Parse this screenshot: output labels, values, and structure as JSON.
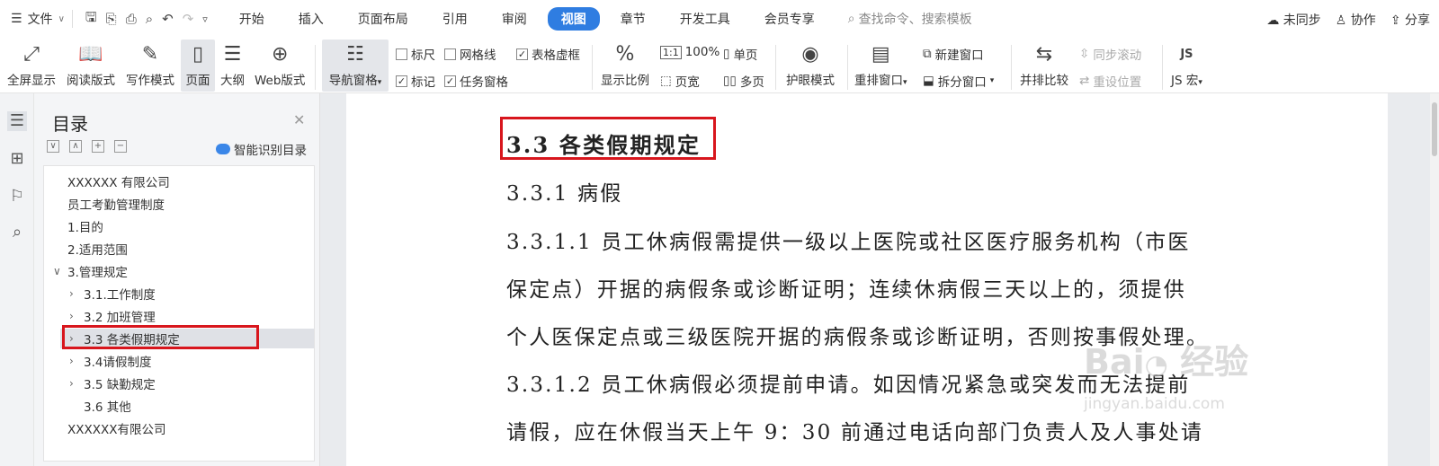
{
  "menubar": {
    "file_label": "文件",
    "tabs": [
      "开始",
      "插入",
      "页面布局",
      "引用",
      "审阅",
      "视图",
      "章节",
      "开发工具",
      "会员专享"
    ],
    "active_tab": "视图",
    "search_placeholder": "查找命令、搜索模板",
    "sync": "未同步",
    "collab": "协作",
    "share": "分享"
  },
  "ribbon": {
    "fullscreen": "全屏显示",
    "reading": "阅读版式",
    "writing": "写作模式",
    "page": "页面",
    "outline": "大纲",
    "web": "Web版式",
    "nav_pane": "导航窗格",
    "ruler": "标尺",
    "gridlines": "网格线",
    "table_border": "表格虚框",
    "mark": "标记",
    "task_pane": "任务窗格",
    "zoom": "显示比例",
    "zoom_100": "100%",
    "page_width": "页宽",
    "single_page": "单页",
    "multi_page": "多页",
    "eye_mode": "护眼模式",
    "arrange": "重排窗口",
    "new_window": "新建窗口",
    "split": "拆分窗口",
    "side_by_side": "并排比较",
    "sync_scroll": "同步滚动",
    "reset_pos": "重设位置",
    "js_macro": "JS 宏"
  },
  "toc": {
    "title": "目录",
    "smart": "智能识别目录",
    "items": [
      {
        "label": "XXXXXX 有限公司",
        "arrow": ""
      },
      {
        "label": "员工考勤管理制度",
        "arrow": ""
      },
      {
        "label": "1.目的",
        "arrow": ""
      },
      {
        "label": "2.适用范围",
        "arrow": ""
      },
      {
        "label": "3.管理规定",
        "arrow": "∨"
      },
      {
        "label": "3.1.工作制度",
        "arrow": "›"
      },
      {
        "label": "3.2 加班管理",
        "arrow": "›"
      },
      {
        "label": "3.3 各类假期规定",
        "arrow": "›"
      },
      {
        "label": "3.4请假制度",
        "arrow": "›"
      },
      {
        "label": "3.5 缺勤规定",
        "arrow": "›"
      },
      {
        "label": "3.6 其他",
        "arrow": ""
      },
      {
        "label": "XXXXXX有限公司",
        "arrow": ""
      }
    ]
  },
  "doc": {
    "heading": "3.3 各类假期规定",
    "sub": "3.3.1 病假",
    "lines": [
      "3.3.1.1 员工休病假需提供一级以上医院或社区医疗服务机构（市医",
      "保定点）开据的病假条或诊断证明；连续休病假三天以上的，须提供",
      "个人医保定点或三级医院开据的病假条或诊断证明，否则按事假处理。",
      "3.3.1.2 员工休病假必须提前申请。如因情况紧急或突发而无法提前",
      "请假，应在休假当天上午 9：30 前通过电话向部门负责人及人事处请"
    ]
  },
  "watermark": {
    "brand": "经验",
    "url": "jingyan.baidu.com"
  }
}
